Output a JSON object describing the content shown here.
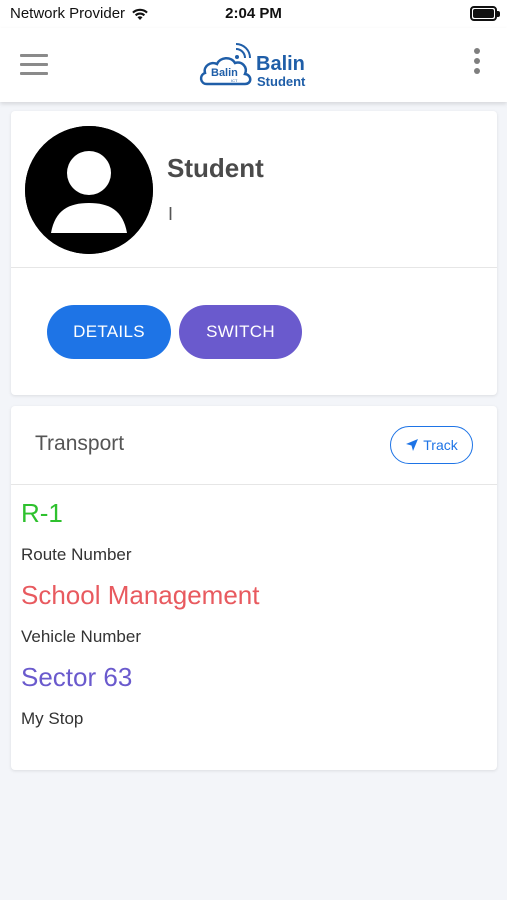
{
  "status_bar": {
    "carrier": "Network Provider",
    "time": "2:04 PM"
  },
  "header": {
    "logo_badge": "Balin",
    "logo_badge_small": "ICT",
    "logo_title": "Balin",
    "logo_subtitle": "Student"
  },
  "profile": {
    "name": "Student",
    "subtitle": "I",
    "details_label": "DETAILS",
    "switch_label": "SWITCH"
  },
  "transport": {
    "title": "Transport",
    "track_label": "Track",
    "route_value": "R-1",
    "route_label": "Route Number",
    "vehicle_value": "School Management",
    "vehicle_label": "Vehicle Number",
    "stop_value": "Sector 63",
    "stop_label": "My Stop"
  },
  "colors": {
    "primary": "#1e74e6",
    "secondary": "#6a5acd",
    "route": "#2ec12e",
    "vehicle": "#e85a5f",
    "stop": "#6a5acd",
    "brand": "#1f5ea8"
  },
  "icons": [
    "wifi-icon",
    "battery-icon",
    "menu-icon",
    "more-vertical-icon",
    "avatar-icon",
    "navigation-arrow-icon"
  ]
}
